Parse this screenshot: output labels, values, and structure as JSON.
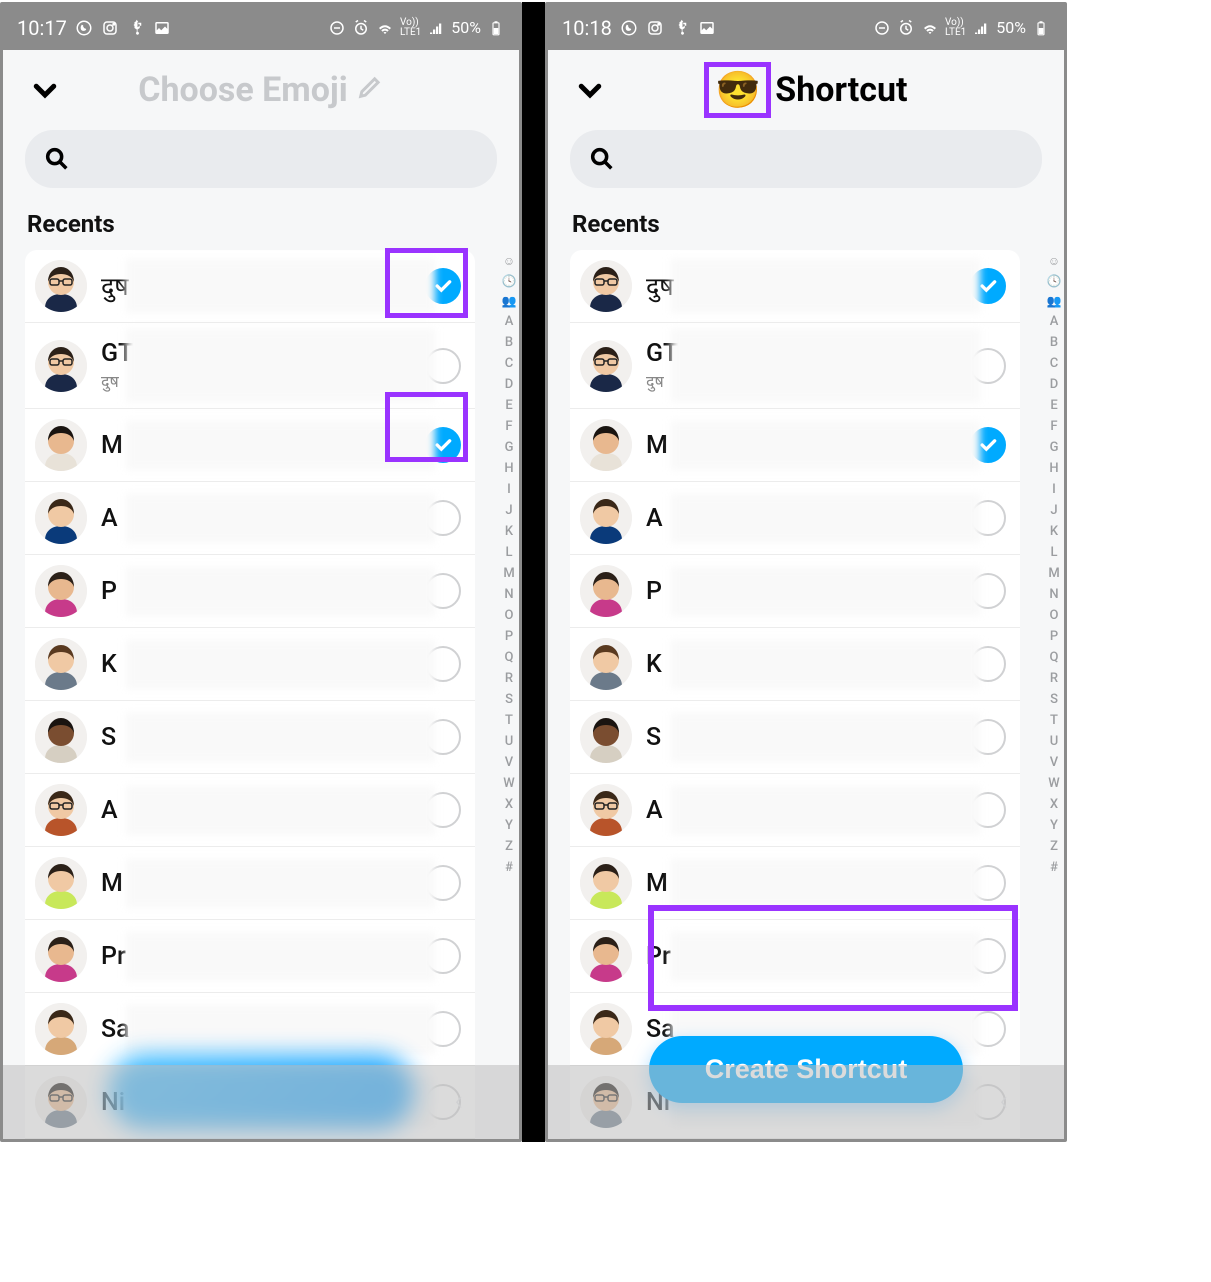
{
  "left": {
    "status": {
      "time": "10:17",
      "battery": "50%"
    },
    "header": {
      "title": "Choose Emoji"
    },
    "section": "Recents",
    "contacts": [
      {
        "name": "दुष",
        "sub": "",
        "checked": true
      },
      {
        "name": "GT",
        "sub": "दुष",
        "checked": false
      },
      {
        "name": "M",
        "sub": "",
        "checked": true
      },
      {
        "name": "A",
        "sub": "",
        "checked": false
      },
      {
        "name": "P",
        "sub": "",
        "checked": false
      },
      {
        "name": "K",
        "sub": "",
        "checked": false
      },
      {
        "name": "S",
        "sub": "",
        "checked": false
      },
      {
        "name": "A",
        "sub": "",
        "checked": false
      },
      {
        "name": "M",
        "sub": "",
        "checked": false
      },
      {
        "name": "Pr",
        "sub": "",
        "checked": false
      },
      {
        "name": "Sa",
        "sub": "",
        "checked": false
      },
      {
        "name": "Ni",
        "sub": "",
        "checked": false
      }
    ]
  },
  "right": {
    "status": {
      "time": "10:18",
      "battery": "50%"
    },
    "header": {
      "emoji": "😎",
      "title": "Shortcut"
    },
    "section": "Recents",
    "button": "Create Shortcut",
    "contacts": [
      {
        "name": "दुष",
        "sub": "",
        "checked": true
      },
      {
        "name": "GT",
        "sub": "दुष",
        "checked": false
      },
      {
        "name": "M",
        "sub": "",
        "checked": true
      },
      {
        "name": "A",
        "sub": "",
        "checked": false
      },
      {
        "name": "P",
        "sub": "",
        "checked": false
      },
      {
        "name": "K",
        "sub": "",
        "checked": false
      },
      {
        "name": "S",
        "sub": "",
        "checked": false
      },
      {
        "name": "A",
        "sub": "",
        "checked": false
      },
      {
        "name": "M",
        "sub": "",
        "checked": false
      },
      {
        "name": "Pr",
        "sub": "",
        "checked": false
      },
      {
        "name": "Sa",
        "sub": "",
        "checked": false
      },
      {
        "name": "Ni",
        "sub": "",
        "checked": false
      }
    ]
  },
  "index": [
    "A",
    "B",
    "C",
    "D",
    "E",
    "F",
    "G",
    "H",
    "I",
    "J",
    "K",
    "L",
    "M",
    "N",
    "O",
    "P",
    "Q",
    "R",
    "S",
    "T",
    "U",
    "V",
    "W",
    "X",
    "Y",
    "Z",
    "#"
  ],
  "avatars": {
    "colors": [
      "#e8c6a8",
      "#e8c6a8",
      "#d9b593",
      "#e8c6a8",
      "#d9b593",
      "#e8c6a8",
      "#8c5b3d",
      "#e8c6a8",
      "#e8c6a8",
      "#d9b593",
      "#e8c6a8",
      "#d9b593"
    ]
  }
}
